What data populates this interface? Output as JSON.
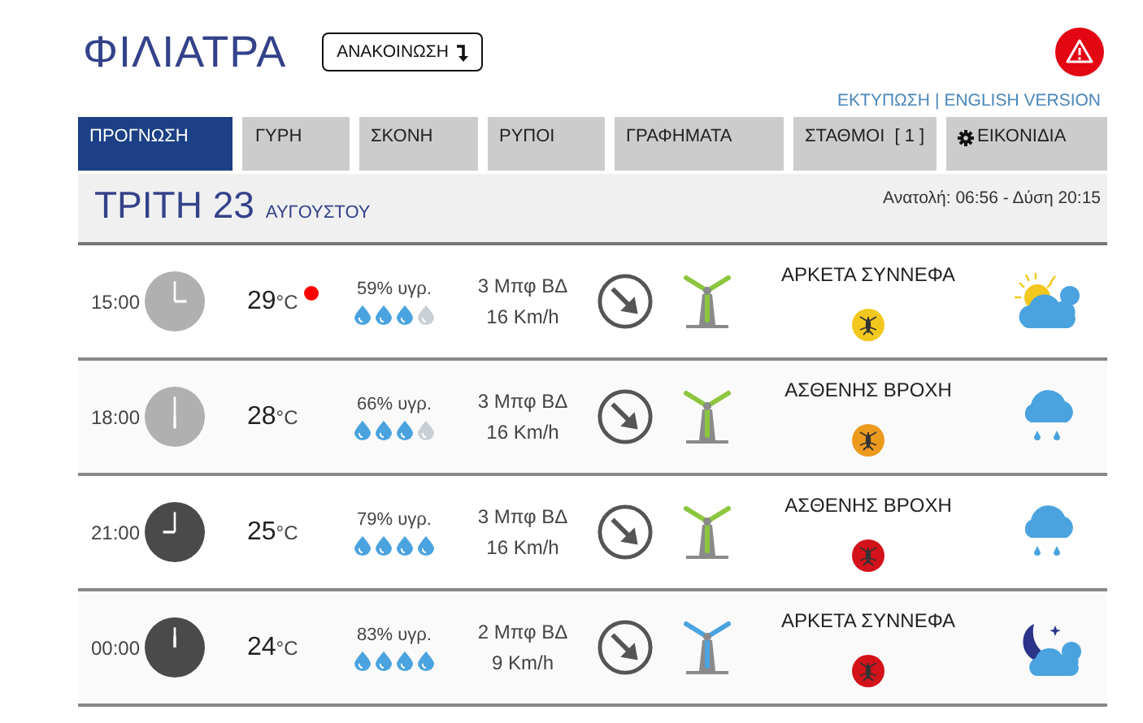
{
  "header": {
    "title": "ΦΙΛΙΑΤΡΑ",
    "announcement_button": "ΑΝΑΚΟΙΝΩΣΗ"
  },
  "links": [
    "ΕΚΤΥΠΩΣΗ",
    "ENGLISH VERSION"
  ],
  "link_separator": "|",
  "tabs": [
    {
      "label": "ΠΡΟΓΝΩΣΗ",
      "selected": true
    },
    {
      "label": "ΓΥΡΗ",
      "selected": false
    },
    {
      "label": "ΣΚΟΝΗ",
      "selected": false
    },
    {
      "label": "ΡΥΠΟΙ",
      "selected": false
    },
    {
      "label": "ΓΡΑΦΗΜΑΤΑ",
      "selected": false
    },
    {
      "label": "ΣΤΑΘΜΟΙ  [ 1 ]",
      "selected": false
    },
    {
      "label": "ΕΙΚΟΝΙΔΙΑ",
      "selected": false,
      "kind": "settings"
    }
  ],
  "day": {
    "weekday_date": "ΤΡΙΤΗ 23",
    "month": "ΑΥΓΟΥΣΤΟΥ",
    "sun": "Ανατολή: 06:56  - Δύση 20:15"
  },
  "rows": [
    {
      "time": "15:00",
      "clock": {
        "kind": "day"
      },
      "temperature": "29",
      "unit": "°C",
      "alert": true,
      "humidity": "59% υγρ.",
      "stars": 3,
      "wind_force": "3 Μπφ ΒΔ",
      "wind_speed": "16 Km/h",
      "turbine": {
        "color": "#8cc63f"
      },
      "condition": "ΑΡΚΕΤΑ ΣΥΝΝΕΦΑ",
      "mosquito": {
        "color": "#f2c81e"
      },
      "weather_icon": {
        "kind": "sun-cloud"
      }
    },
    {
      "time": "18:00",
      "clock": {
        "kind": "day"
      },
      "temperature": "28",
      "unit": "°C",
      "alert": false,
      "humidity": "66% υγρ.",
      "stars": 3,
      "wind_force": "3 Μπφ ΒΔ",
      "wind_speed": "16 Km/h",
      "turbine": {
        "color": "#8cc63f"
      },
      "condition": "ΑΣΘΕΝΗΣ ΒΡΟΧΗ",
      "mosquito": {
        "color": "#ec9a1e"
      },
      "weather_icon": {
        "kind": "rain"
      }
    },
    {
      "time": "21:00",
      "clock": {
        "kind": "night"
      },
      "temperature": "25",
      "unit": "°C",
      "alert": false,
      "humidity": "79% υγρ.",
      "stars": 4,
      "wind_force": "3 Μπφ ΒΔ",
      "wind_speed": "16 Km/h",
      "turbine": {
        "color": "#8cc63f"
      },
      "condition": "ΑΣΘΕΝΗΣ ΒΡΟΧΗ",
      "mosquito": {
        "color": "#d3121a"
      },
      "weather_icon": {
        "kind": "rain"
      }
    },
    {
      "time": "00:00",
      "clock": {
        "kind": "night"
      },
      "temperature": "24",
      "unit": "°C",
      "alert": false,
      "humidity": "83% υγρ.",
      "stars": 4,
      "wind_force": "2 Μπφ ΒΔ",
      "wind_speed": "9 Km/h",
      "turbine": {
        "color": "#4aa3df"
      },
      "condition": "ΑΡΚΕΤΑ ΣΥΝΝΕΦΑ",
      "mosquito": {
        "color": "#d3121a"
      },
      "weather_icon": {
        "kind": "moon-cloud"
      }
    }
  ]
}
